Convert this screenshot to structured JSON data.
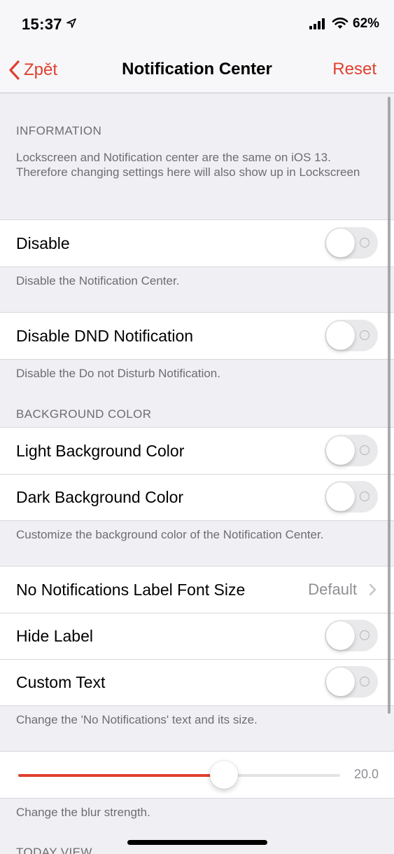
{
  "status_bar": {
    "time": "15:37",
    "battery": "62%"
  },
  "nav": {
    "back_label": "Zpět",
    "title": "Notification Center",
    "reset_label": "Reset"
  },
  "information": {
    "header": "INFORMATION",
    "text": "Lockscreen and Notification center are the same on iOS 13. Therefore changing settings here will also show up in Lockscreen"
  },
  "disable": {
    "label": "Disable",
    "enabled": false,
    "footer": "Disable the Notification Center."
  },
  "disable_dnd": {
    "label": "Disable DND Notification",
    "enabled": false,
    "footer": "Disable the Do not Disturb Notification."
  },
  "background_color": {
    "header": "BACKGROUND COLOR",
    "light_label": "Light Background Color",
    "light_enabled": false,
    "dark_label": "Dark Background Color",
    "dark_enabled": false,
    "footer": "Customize the background color of the Notification Center."
  },
  "no_notifications": {
    "font_size_label": "No Notifications Label Font Size",
    "font_size_value": "Default",
    "hide_label": "Hide Label",
    "hide_enabled": false,
    "custom_text_label": "Custom Text",
    "custom_text_enabled": false,
    "footer": "Change the 'No Notifications' text and its size."
  },
  "blur": {
    "value_text": "20.0",
    "fraction": 0.64,
    "footer": "Change the blur strength."
  },
  "today_view": {
    "header": "TODAY VIEW"
  },
  "colors": {
    "accent": "#e0402f"
  }
}
